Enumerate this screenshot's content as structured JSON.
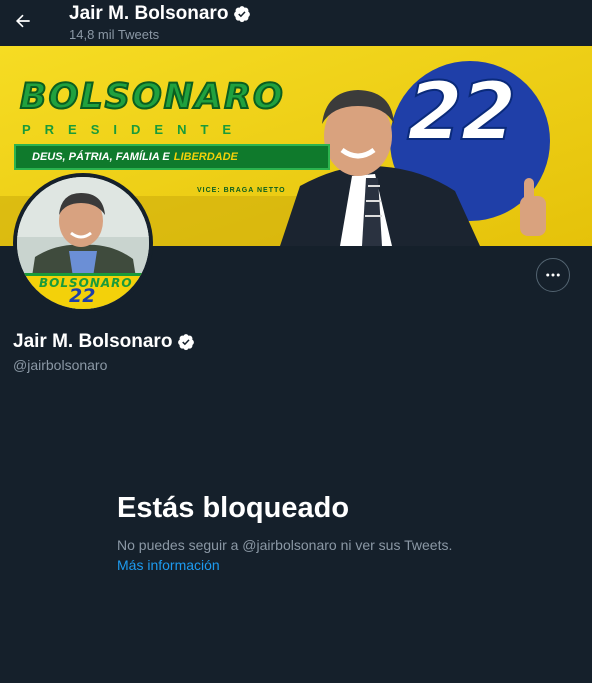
{
  "header": {
    "back_icon": "arrow-left-icon",
    "name": "Jair M. Bolsonaro",
    "tweet_count": "14,8 mil Tweets"
  },
  "banner": {
    "logo_text": "BOLSONARO",
    "subtitle": "PRESIDENTE",
    "slogan_main": "DEUS, PÁTRIA, FAMÍLIA E",
    "slogan_highlight": "LIBERDADE",
    "vice": "VICE: BRAGA NETTO",
    "number": "22"
  },
  "avatar": {
    "logo_text": "BOLSONARO",
    "number": "22"
  },
  "profile": {
    "name": "Jair M. Bolsonaro",
    "handle": "@jairbolsonaro",
    "more_icon": "more-options-icon",
    "verified_icon": "verified-badge-icon"
  },
  "blocked": {
    "title": "Estás bloqueado",
    "message": "No puedes seguir a @jairbolsonaro ni ver sus Tweets.",
    "link": "Más información"
  },
  "colors": {
    "background": "#15202b",
    "secondary_text": "#8b98a5",
    "link": "#1d9bf0",
    "banner_yellow": "#f3d10a",
    "banner_green": "#0f7a2c",
    "banner_blue": "#1f3fa8"
  }
}
